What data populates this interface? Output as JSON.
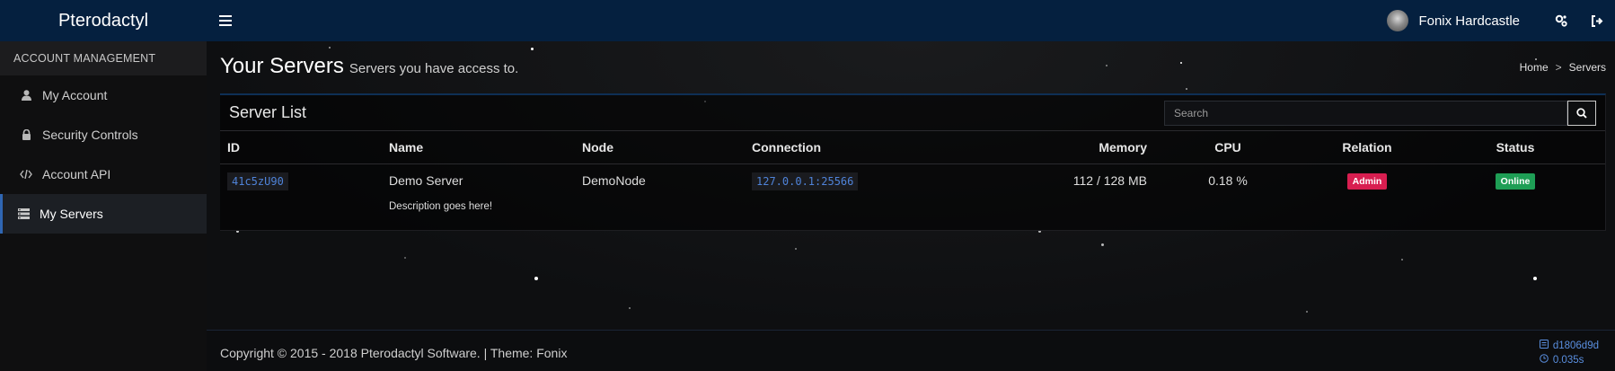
{
  "app": {
    "brand": "Pterodactyl"
  },
  "topbar": {
    "user_name": "Fonix Hardcastle",
    "icons": [
      "menu-icon",
      "admin-settings-icon",
      "logout-icon"
    ]
  },
  "sidebar": {
    "header": "ACCOUNT MANAGEMENT",
    "items": [
      {
        "label": "My Account",
        "icon": "user-icon",
        "active": false
      },
      {
        "label": "Security Controls",
        "icon": "lock-icon",
        "active": false
      },
      {
        "label": "Account API",
        "icon": "code-icon",
        "active": false
      },
      {
        "label": "My Servers",
        "icon": "server-icon",
        "active": true
      }
    ]
  },
  "page": {
    "title": "Your Servers",
    "subtitle": "Servers you have access to.",
    "breadcrumb": [
      "Home",
      "Servers"
    ]
  },
  "server_list": {
    "title": "Server List",
    "search_placeholder": "Search",
    "columns": [
      "ID",
      "Name",
      "Node",
      "Connection",
      "Memory",
      "CPU",
      "Relation",
      "Status"
    ],
    "rows": [
      {
        "id": "41c5zU90",
        "name": "Demo Server",
        "node": "DemoNode",
        "connection": "127.0.0.1:25566",
        "memory": "112 / 128 MB",
        "cpu": "0.18 %",
        "relation": "Admin",
        "status": "Online",
        "description": "Description goes here!"
      }
    ]
  },
  "footer": {
    "copyright": "Copyright © 2015 - 2018 Pterodactyl Software. | Theme: Fonix",
    "version": "d1806d9d",
    "render_time": "0.035s"
  },
  "colors": {
    "topbar": "#05203f",
    "accent": "#2f66b3",
    "admin_badge": "#d81e50",
    "online_badge": "#1e9e55",
    "code_text": "#4f83d9"
  }
}
